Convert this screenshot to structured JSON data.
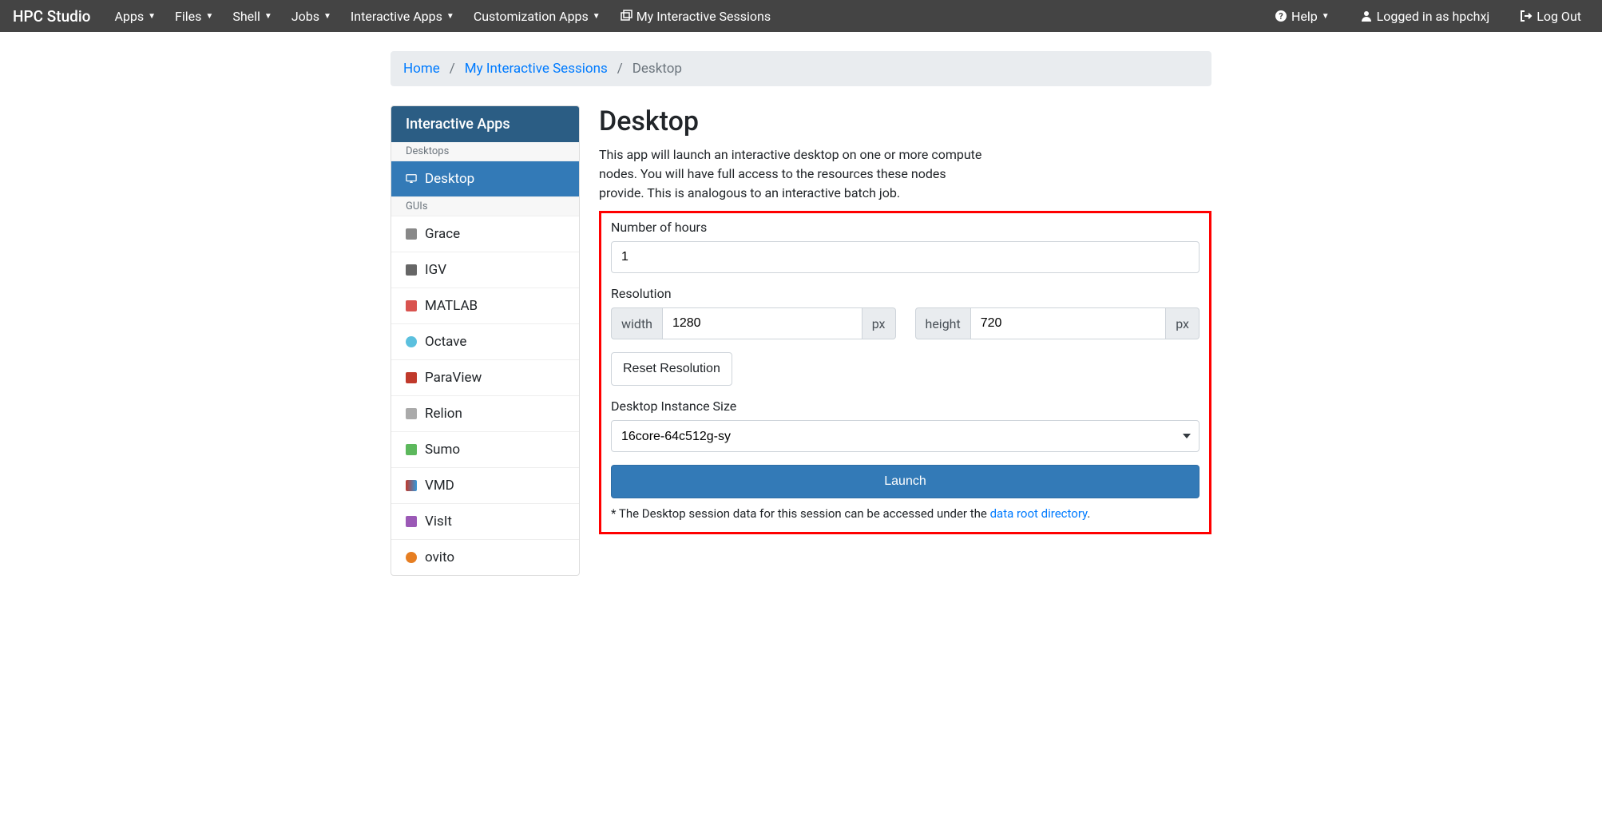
{
  "navbar": {
    "brand": "HPC Studio",
    "left": [
      {
        "label": "Apps",
        "dropdown": true
      },
      {
        "label": "Files",
        "dropdown": true
      },
      {
        "label": "Shell",
        "dropdown": true
      },
      {
        "label": "Jobs",
        "dropdown": true
      },
      {
        "label": "Interactive Apps",
        "dropdown": true
      },
      {
        "label": "Customization Apps",
        "dropdown": true
      },
      {
        "label": "My Interactive Sessions",
        "dropdown": false,
        "icon": "window-restore"
      }
    ],
    "right": {
      "help": "Help",
      "logged_in": "Logged in as hpchxj",
      "logout": "Log Out"
    }
  },
  "breadcrumb": {
    "items": [
      {
        "label": "Home",
        "link": true
      },
      {
        "label": "My Interactive Sessions",
        "link": true
      },
      {
        "label": "Desktop",
        "link": false
      }
    ]
  },
  "sidebar": {
    "header": "Interactive Apps",
    "categories": [
      {
        "label": "Desktops",
        "items": [
          {
            "label": "Desktop",
            "icon": "desktop",
            "active": true
          }
        ]
      },
      {
        "label": "GUIs",
        "items": [
          {
            "label": "Grace",
            "icon_color": "#888"
          },
          {
            "label": "IGV",
            "icon_color": "#666"
          },
          {
            "label": "MATLAB",
            "icon_color": "#d9534f"
          },
          {
            "label": "Octave",
            "icon_color": "#5bc0de"
          },
          {
            "label": "ParaView",
            "icon_color": "#c0392b"
          },
          {
            "label": "Relion",
            "icon_color": "#aaa"
          },
          {
            "label": "Sumo",
            "icon_color": "#5cb85c"
          },
          {
            "label": "VMD",
            "icon_color": "#c0392b"
          },
          {
            "label": "VisIt",
            "icon_color": "#9b59b6"
          },
          {
            "label": "ovito",
            "icon_color": "#e67e22"
          }
        ]
      }
    ]
  },
  "content": {
    "title": "Desktop",
    "description": "This app will launch an interactive desktop on one or more compute nodes. You will have full access to the resources these nodes provide. This is analogous to an interactive batch job.",
    "form": {
      "hours_label": "Number of hours",
      "hours_value": "1",
      "resolution_label": "Resolution",
      "width_label": "width",
      "width_value": "1280",
      "height_label": "height",
      "height_value": "720",
      "px": "px",
      "reset_label": "Reset Resolution",
      "instance_label": "Desktop Instance Size",
      "instance_value": "16core-64c512g-sy",
      "launch_label": "Launch",
      "footnote_prefix": "* The Desktop session data for this session can be accessed under the ",
      "footnote_link": "data root directory",
      "footnote_suffix": "."
    }
  }
}
